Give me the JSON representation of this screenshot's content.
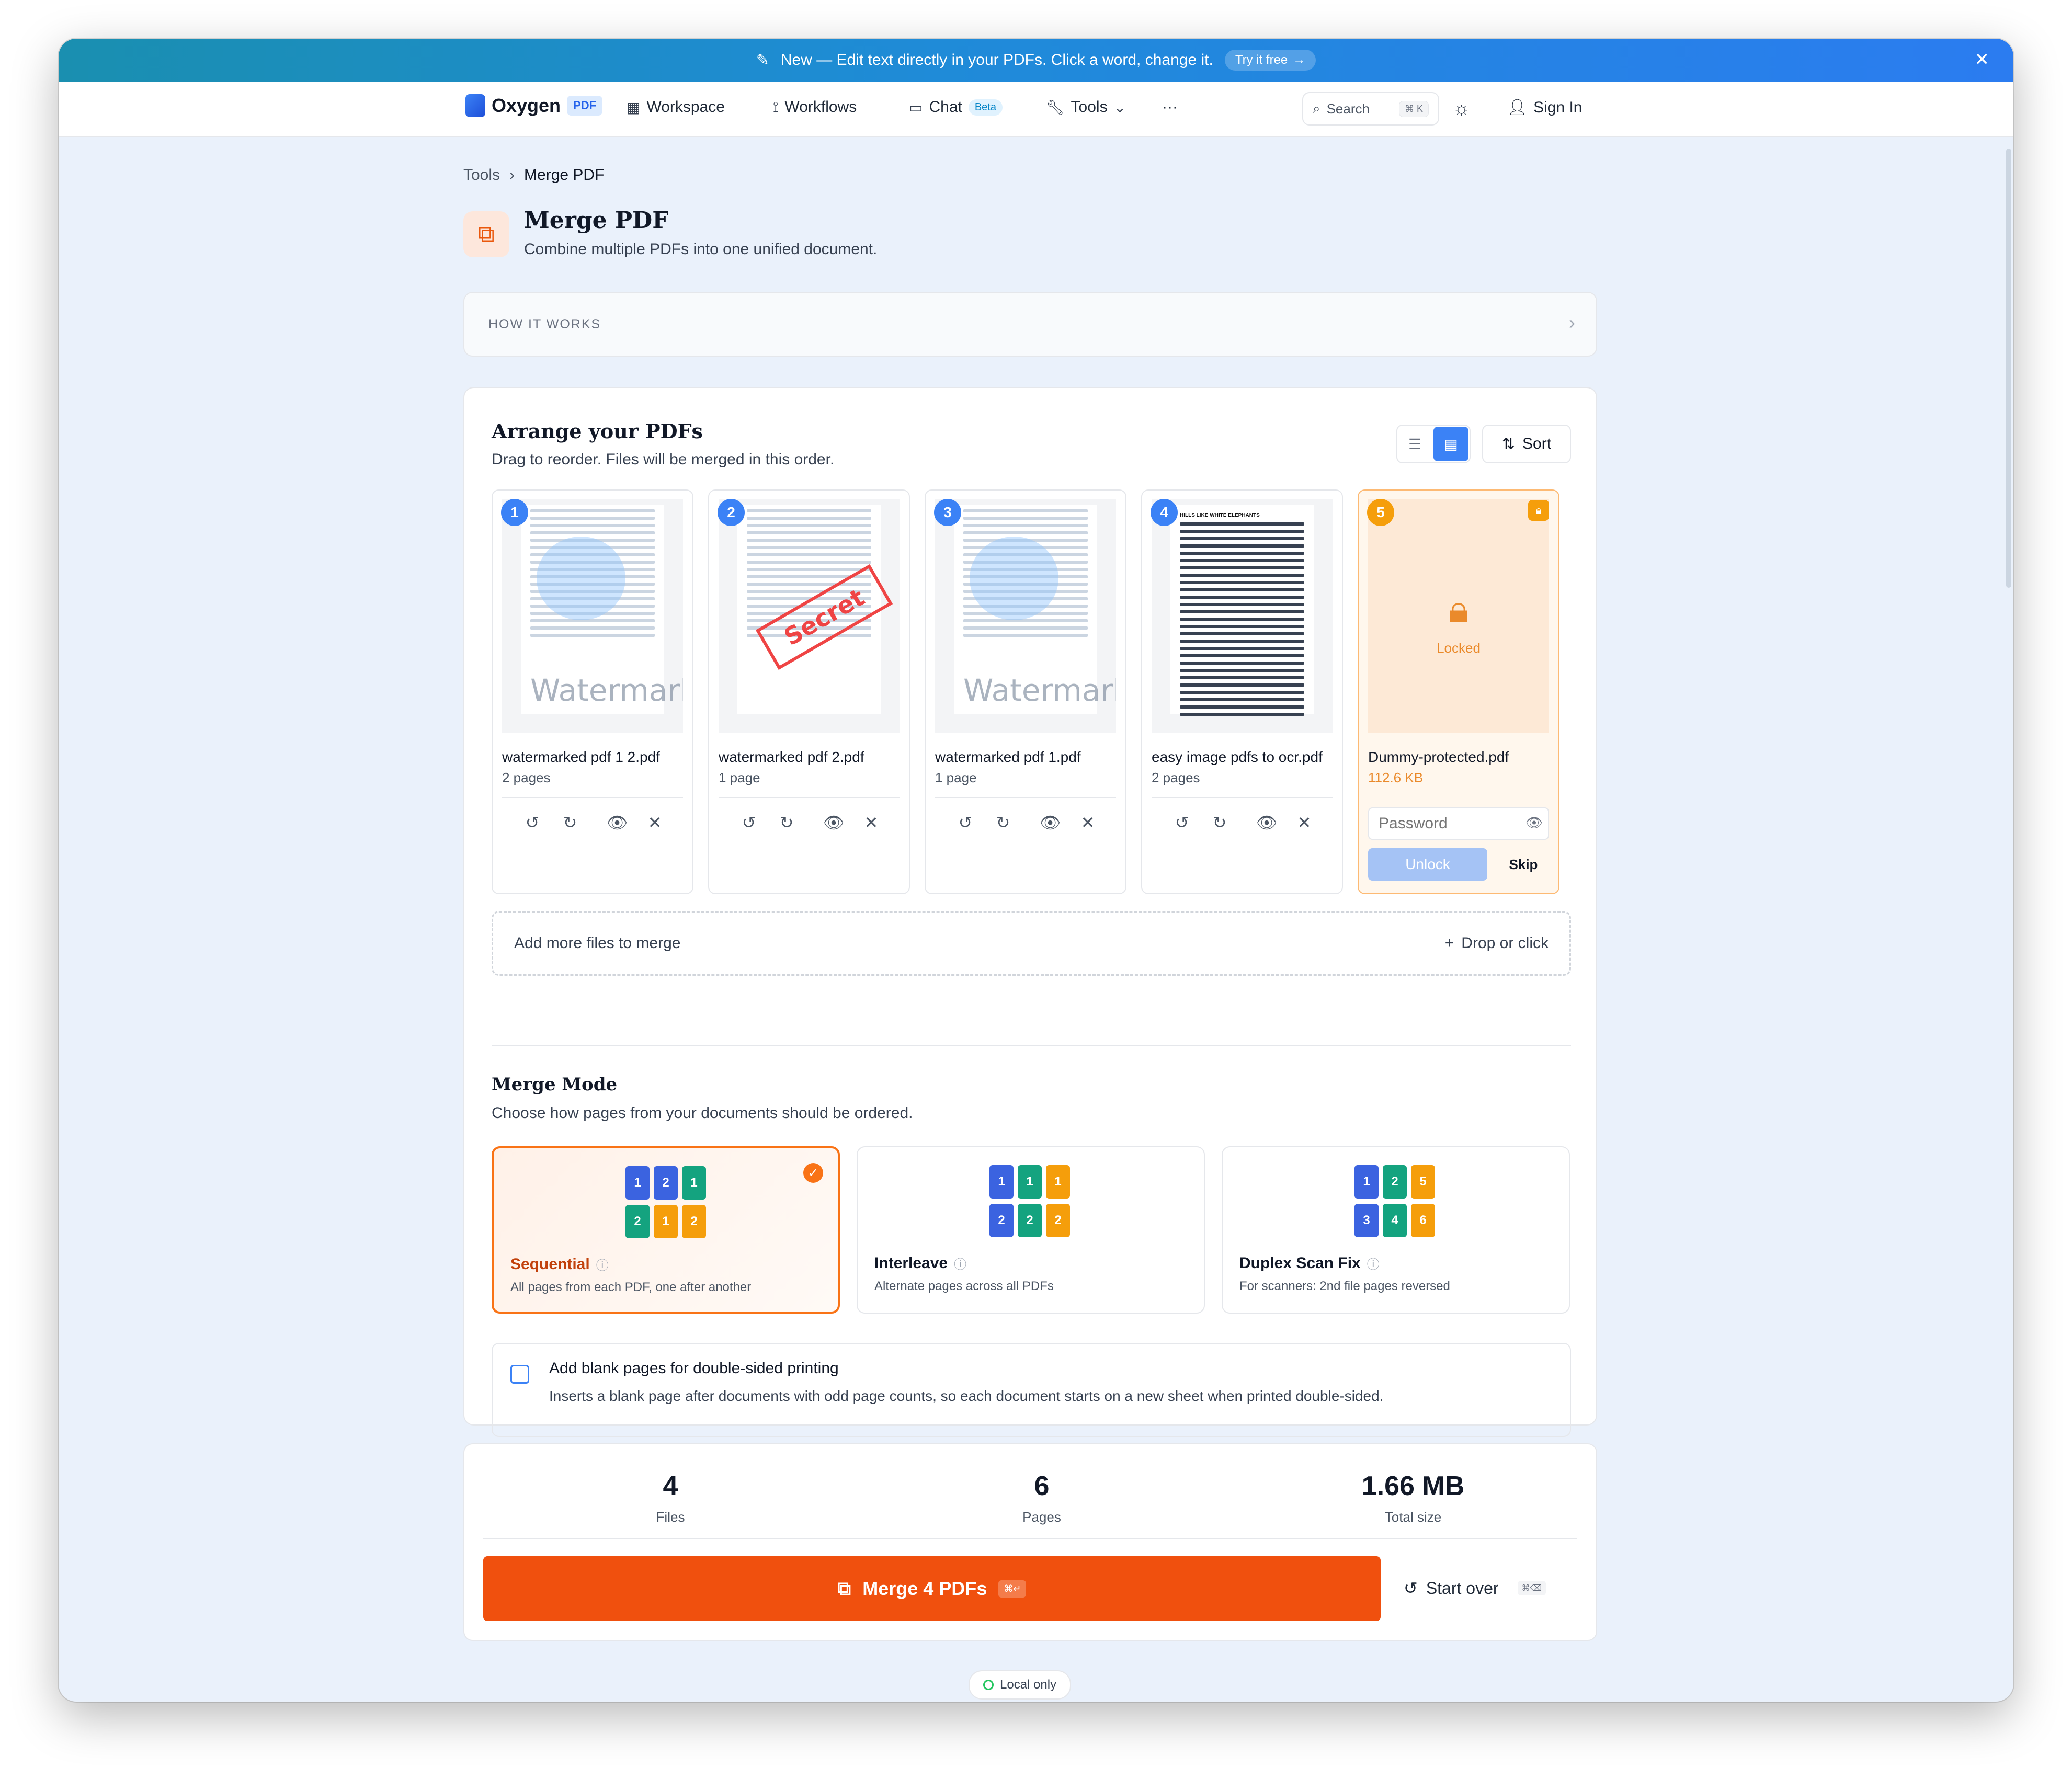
{
  "banner": {
    "text": "New — Edit text directly in your PDFs. Click a word, change it.",
    "cta": "Try it free"
  },
  "nav": {
    "brand": "Oxygen",
    "brand_tag": "PDF",
    "items": [
      {
        "label": "Workspace"
      },
      {
        "label": "Workflows"
      },
      {
        "label": "Chat",
        "badge": "Beta"
      },
      {
        "label": "Tools"
      }
    ],
    "more": "···",
    "search_label": "Search",
    "search_kbd": "⌘ K",
    "signin": "Sign In"
  },
  "breadcrumb": {
    "parent": "Tools",
    "sep": "›",
    "current": "Merge PDF"
  },
  "page": {
    "title": "Merge PDF",
    "subtitle": "Combine multiple PDFs into one unified document."
  },
  "how_it_works": "HOW IT WORKS",
  "arrange": {
    "title": "Arrange your PDFs",
    "subtitle": "Drag to reorder. Files will be merged in this order.",
    "sort": "Sort",
    "files": [
      {
        "num": "1",
        "name": "watermarked pdf 1 2.pdf",
        "meta": "2 pages",
        "thumb_mark": "Watermark"
      },
      {
        "num": "2",
        "name": "watermarked pdf 2.pdf",
        "meta": "1 page",
        "thumb_mark": "Secret"
      },
      {
        "num": "3",
        "name": "watermarked pdf 1.pdf",
        "meta": "1 page",
        "thumb_mark": "Watermark"
      },
      {
        "num": "4",
        "name": "easy image pdfs to ocr.pdf",
        "meta": "2 pages",
        "thumb_heading": "HILLS LIKE WHITE ELEPHANTS"
      }
    ],
    "locked_file": {
      "num": "5",
      "name": "Dummy-protected.pdf",
      "size": "112.6 KB",
      "locked_label": "Locked",
      "password_placeholder": "Password",
      "unlock": "Unlock",
      "skip": "Skip"
    },
    "dropzone": {
      "label": "Add more files to merge",
      "action": "Drop or click"
    }
  },
  "merge_mode": {
    "title": "Merge Mode",
    "subtitle": "Choose how pages from your documents should be ordered.",
    "modes": [
      {
        "name": "Sequential",
        "desc": "All pages from each PDF, one after another",
        "selected": true
      },
      {
        "name": "Interleave",
        "desc": "Alternate pages across all PDFs",
        "selected": false
      },
      {
        "name": "Duplex Scan Fix",
        "desc": "For scanners: 2nd file pages reversed",
        "selected": false
      }
    ],
    "tiles": {
      "sequential": [
        "1",
        "2",
        "1",
        "2",
        "1",
        "2"
      ],
      "interleave": [
        "1",
        "1",
        "1",
        "2",
        "2",
        "2"
      ],
      "duplex": [
        "1",
        "2",
        "5",
        "3",
        "4",
        "6"
      ]
    }
  },
  "blank_pages": {
    "label": "Add blank pages for double-sided printing",
    "desc": "Inserts a blank page after documents with odd page counts, so each document starts on a new sheet when printed double-sided.",
    "checked": false
  },
  "stats": {
    "files": {
      "value": "4",
      "label": "Files"
    },
    "pages": {
      "value": "6",
      "label": "Pages"
    },
    "size": {
      "value": "1.66 MB",
      "label": "Total size"
    }
  },
  "merge_button": {
    "label": "Merge 4 PDFs",
    "kbd": "⌘↵"
  },
  "start_over": {
    "label": "Start over",
    "kbd": "⌘⌫"
  },
  "local_only": "Local only",
  "colors": {
    "accent": "#f0500e",
    "blue": "#3b82f6",
    "banner": "#1f8bd8"
  }
}
